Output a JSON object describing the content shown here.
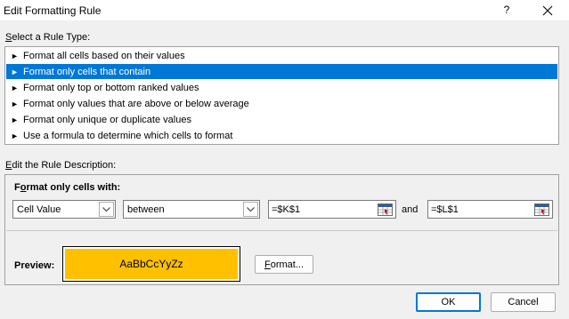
{
  "window": {
    "title": "Edit Formatting Rule",
    "help_label": "?"
  },
  "rule_type": {
    "label_prefix": "",
    "label_accel": "S",
    "label_rest": "elect a Rule Type:",
    "items": [
      {
        "label": "Format all cells based on their values",
        "selected": false
      },
      {
        "label": "Format only cells that contain",
        "selected": true
      },
      {
        "label": "Format only top or bottom ranked values",
        "selected": false
      },
      {
        "label": "Format only values that are above or below average",
        "selected": false
      },
      {
        "label": "Format only unique or duplicate values",
        "selected": false
      },
      {
        "label": "Use a formula to determine which cells to format",
        "selected": false
      }
    ]
  },
  "description": {
    "label_accel": "E",
    "label_rest": "dit the Rule Description:",
    "format_only_prefix": "F",
    "format_only_accel": "o",
    "format_only_rest": "rmat only cells with:",
    "condition_type": "Cell Value",
    "operator": "between",
    "value1": "=$K$1",
    "and_label": "and",
    "value2": "=$L$1",
    "preview_label": "Preview:",
    "preview_text": "AaBbCcYyZz",
    "preview_fill": "#ffc000",
    "format_button_accel": "F",
    "format_button_rest": "ormat..."
  },
  "buttons": {
    "ok": "OK",
    "cancel": "Cancel"
  },
  "colors": {
    "selection": "#0078d7",
    "accent_border": "#0078d7"
  }
}
